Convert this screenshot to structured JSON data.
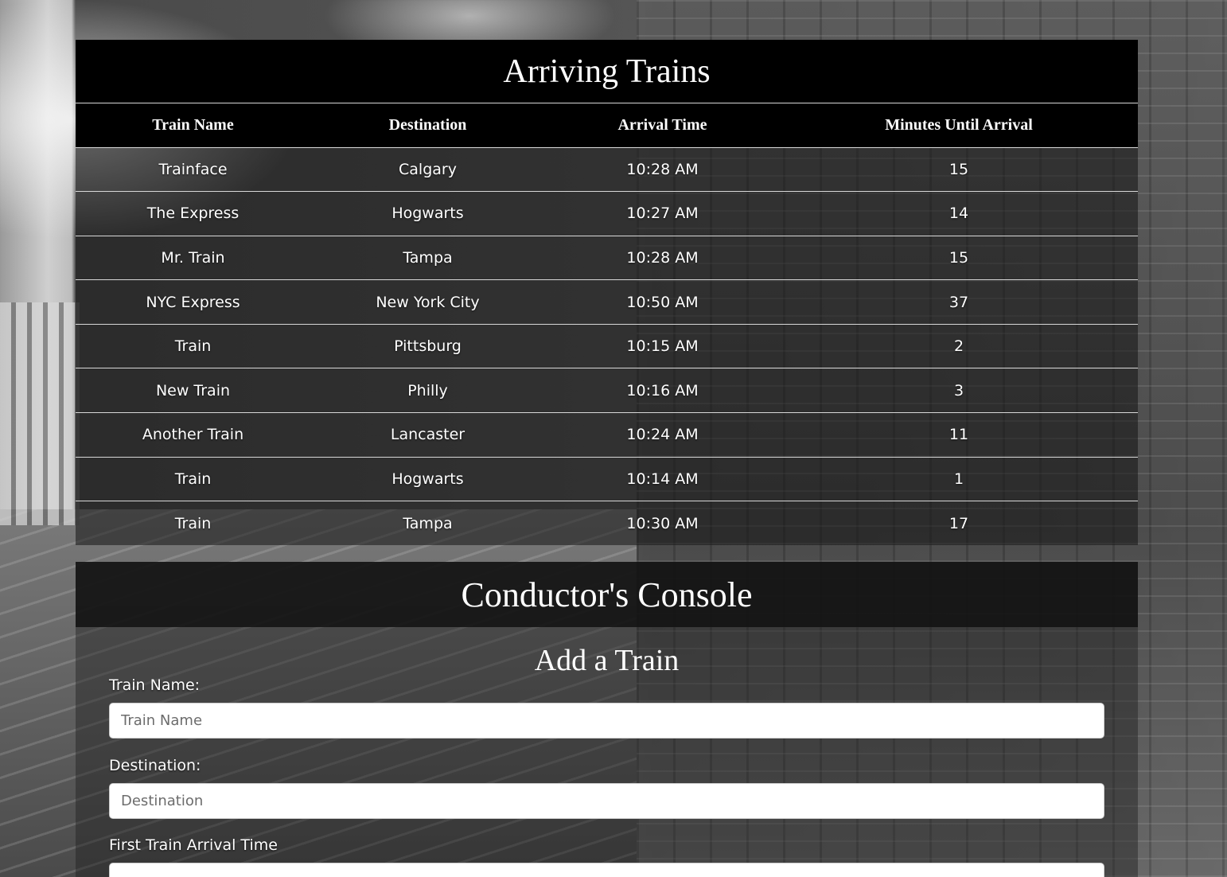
{
  "arriving": {
    "title": "Arriving Trains",
    "columns": [
      "Train Name",
      "Destination",
      "Arrival Time",
      "Minutes Until Arrival"
    ],
    "rows": [
      [
        "Trainface",
        "Calgary",
        "10:28 AM",
        "15"
      ],
      [
        "The Express",
        "Hogwarts",
        "10:27 AM",
        "14"
      ],
      [
        "Mr. Train",
        "Tampa",
        "10:28 AM",
        "15"
      ],
      [
        "NYC Express",
        "New York City",
        "10:50 AM",
        "37"
      ],
      [
        "Train",
        "Pittsburg",
        "10:15 AM",
        "2"
      ],
      [
        "New Train",
        "Philly",
        "10:16 AM",
        "3"
      ],
      [
        "Another Train",
        "Lancaster",
        "10:24 AM",
        "11"
      ],
      [
        "Train",
        "Hogwarts",
        "10:14 AM",
        "1"
      ],
      [
        "Train",
        "Tampa",
        "10:30 AM",
        "17"
      ]
    ]
  },
  "console": {
    "title": "Conductor's Console",
    "form_title": "Add a Train",
    "fields": {
      "train_name": {
        "label": "Train Name:",
        "placeholder": "Train Name",
        "value": ""
      },
      "destination": {
        "label": "Destination:",
        "placeholder": "Destination",
        "value": ""
      },
      "first_time": {
        "label": "First Train Arrival Time",
        "placeholder": "",
        "value": ""
      }
    }
  }
}
